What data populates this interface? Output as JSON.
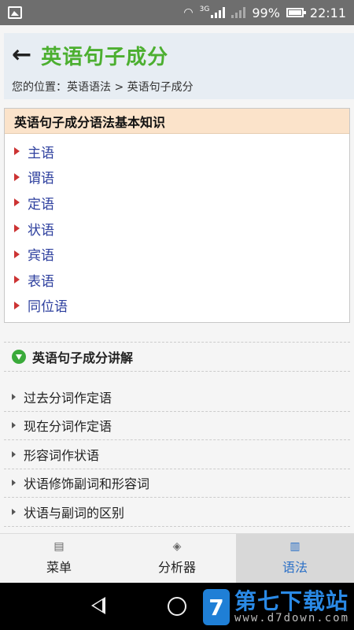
{
  "status": {
    "battery": "99%",
    "time": "22:11",
    "network": "3G"
  },
  "header": {
    "back_icon": "←",
    "title": "英语句子成分",
    "breadcrumb_prefix": "您的位置：",
    "breadcrumb_link1": "英语语法",
    "breadcrumb_sep": " > ",
    "breadcrumb_link2": "英语句子成分"
  },
  "knowledge": {
    "title": "英语句子成分语法基本知识",
    "items": [
      "主语",
      "谓语",
      "定语",
      "状语",
      "宾语",
      "表语",
      "同位语"
    ]
  },
  "explain": {
    "title": "英语句子成分讲解",
    "items": [
      "过去分词作定语",
      "现在分词作定语",
      "形容词作状语",
      "状语修饰副词和形容词",
      "状语与副词的区别"
    ]
  },
  "bottom_nav": {
    "items": [
      {
        "label": "菜单",
        "icon": "list-icon"
      },
      {
        "label": "分析器",
        "icon": "layers-icon"
      },
      {
        "label": "语法",
        "icon": "book-icon"
      }
    ],
    "active": "语法"
  },
  "watermark": {
    "logo": "7",
    "title": "第七下载站",
    "url": "www.d7down.com"
  }
}
